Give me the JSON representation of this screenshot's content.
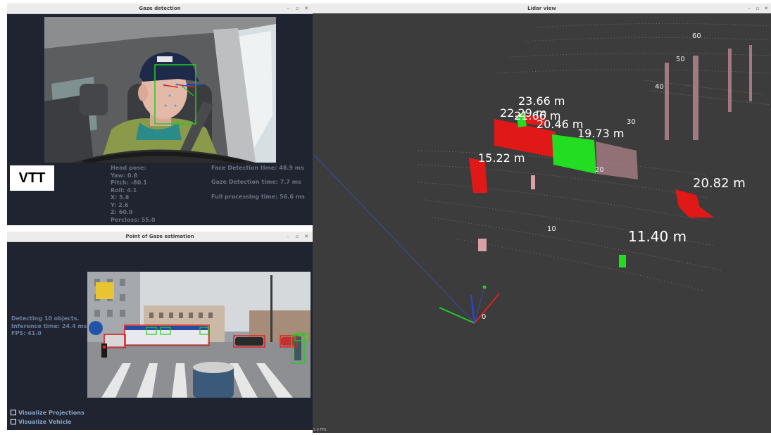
{
  "gaze_window": {
    "title": "Gaze detection",
    "controls": [
      "–",
      "▫",
      "✕"
    ],
    "logo": "VTT",
    "head_pose": [
      "Head pose:",
      "Yaw: 0.8",
      "Pitch: -80.1",
      "Roll: 4.1",
      "X: 5.8",
      "Y: 2.6",
      "Z: 60.9",
      "Percloss: 55.0"
    ],
    "timings": [
      "Face Detection time: 48.9 ms",
      "Gaze Detection time: 7.7 ms",
      "Full processing time: 56.6 ms"
    ]
  },
  "pog_window": {
    "title": "Point of Gaze estimation",
    "controls": [
      "–",
      "▫",
      "✕"
    ],
    "stats": [
      "Detecting 10 objects.",
      "Inference time: 24.4 ms.",
      "FPS: 41.0"
    ],
    "checkboxes": [
      "Visualize Projections",
      "Visualize Vehicle"
    ]
  },
  "lidar_window": {
    "title": "Lidar view",
    "controls": [
      "–",
      "▫",
      "✕"
    ],
    "footer": "5.0 FPS",
    "grid_labels": [
      "60",
      "50",
      "40",
      "30",
      "20",
      "10",
      "0"
    ],
    "distances": [
      "23.66 m",
      "22.29 m",
      "21.66 m",
      "20.46 m",
      "19.73 m",
      "15.22 m",
      "20.82 m",
      "11.40 m"
    ]
  },
  "colors": {
    "panel_bg": "#1f2430",
    "lidar_bg": "#3c3c3c",
    "point_red": "#e01818",
    "point_green": "#22dd22",
    "point_pink": "#d9a0a8",
    "box_green": "#22cc22",
    "box_red": "#e02020"
  }
}
